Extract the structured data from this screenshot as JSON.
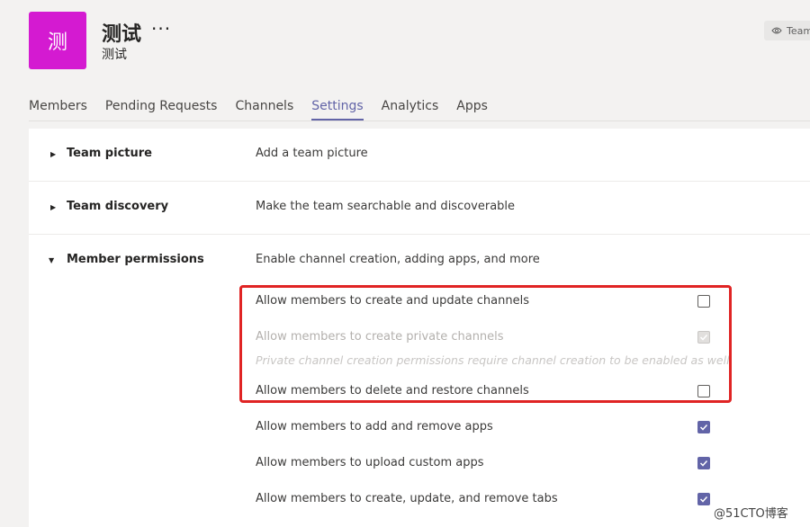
{
  "header": {
    "avatar_glyph": "测",
    "team_name": "测试",
    "team_sub": "测试",
    "more_label": "···",
    "view_button_label": "Team"
  },
  "tabs": [
    {
      "label": "Members"
    },
    {
      "label": "Pending Requests"
    },
    {
      "label": "Channels"
    },
    {
      "label": "Settings",
      "active": true
    },
    {
      "label": "Analytics"
    },
    {
      "label": "Apps"
    }
  ],
  "sections": {
    "team_picture": {
      "title": "Team picture",
      "description": "Add a team picture",
      "expanded": false
    },
    "team_discovery": {
      "title": "Team discovery",
      "description": "Make the team searchable and discoverable",
      "expanded": false
    },
    "member_permissions": {
      "title": "Member permissions",
      "description": "Enable channel creation, adding apps, and more",
      "expanded": true
    }
  },
  "options": [
    {
      "label": "Allow members to create and update channels",
      "checked": false,
      "disabled": false
    },
    {
      "label": "Allow members to create private channels",
      "checked": true,
      "disabled": true
    },
    {
      "label": "Allow members to delete and restore channels",
      "checked": false,
      "disabled": false
    },
    {
      "label": "Allow members to add and remove apps",
      "checked": true,
      "disabled": false
    },
    {
      "label": "Allow members to upload custom apps",
      "checked": true,
      "disabled": false
    },
    {
      "label": "Allow members to create, update, and remove tabs",
      "checked": true,
      "disabled": false
    }
  ],
  "private_note": "Private channel creation permissions require channel creation to be enabled as well.",
  "watermark": "@51CTO博客",
  "colors": {
    "avatar": "#d41ad1",
    "accent": "#6264a7",
    "highlight_box": "#e02424"
  }
}
